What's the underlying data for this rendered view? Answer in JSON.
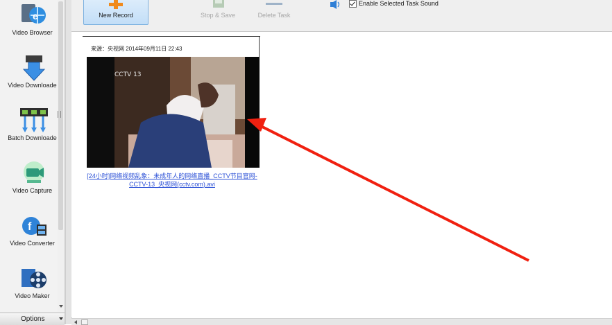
{
  "sidebar": {
    "items": [
      {
        "label": "Video Browser",
        "icon": "globe-browser-icon"
      },
      {
        "label": "Video Downloade",
        "icon": "download-arrow-icon"
      },
      {
        "label": "Batch Downloade",
        "icon": "batch-download-icon"
      },
      {
        "label": "Video Capture",
        "icon": "video-camera-icon"
      },
      {
        "label": "Video Converter",
        "icon": "video-converter-icon"
      },
      {
        "label": "Video Maker",
        "icon": "film-reel-icon"
      }
    ],
    "options_label": "Options"
  },
  "toolbar": {
    "new_record_label": "New Record",
    "stop_save_label": "Stop & Save",
    "delete_task_label": "Delete Task",
    "enable_sound_label": "Enable Selected Task Sound",
    "enable_sound_checked": true
  },
  "content": {
    "thumbnail_caption": "来源：央视网 2014年09月11日 22:43",
    "file_name": "[24小时]网络视频乱象：未成年人的网络直播_CCTV节目官网-CCTV-13_央视网(cctv.com).avi",
    "video_overlay": "CCTV 13"
  },
  "colors": {
    "link": "#2a4fd6",
    "annotation_arrow": "#f02010",
    "new_record_bg": "#c8e1f8"
  }
}
